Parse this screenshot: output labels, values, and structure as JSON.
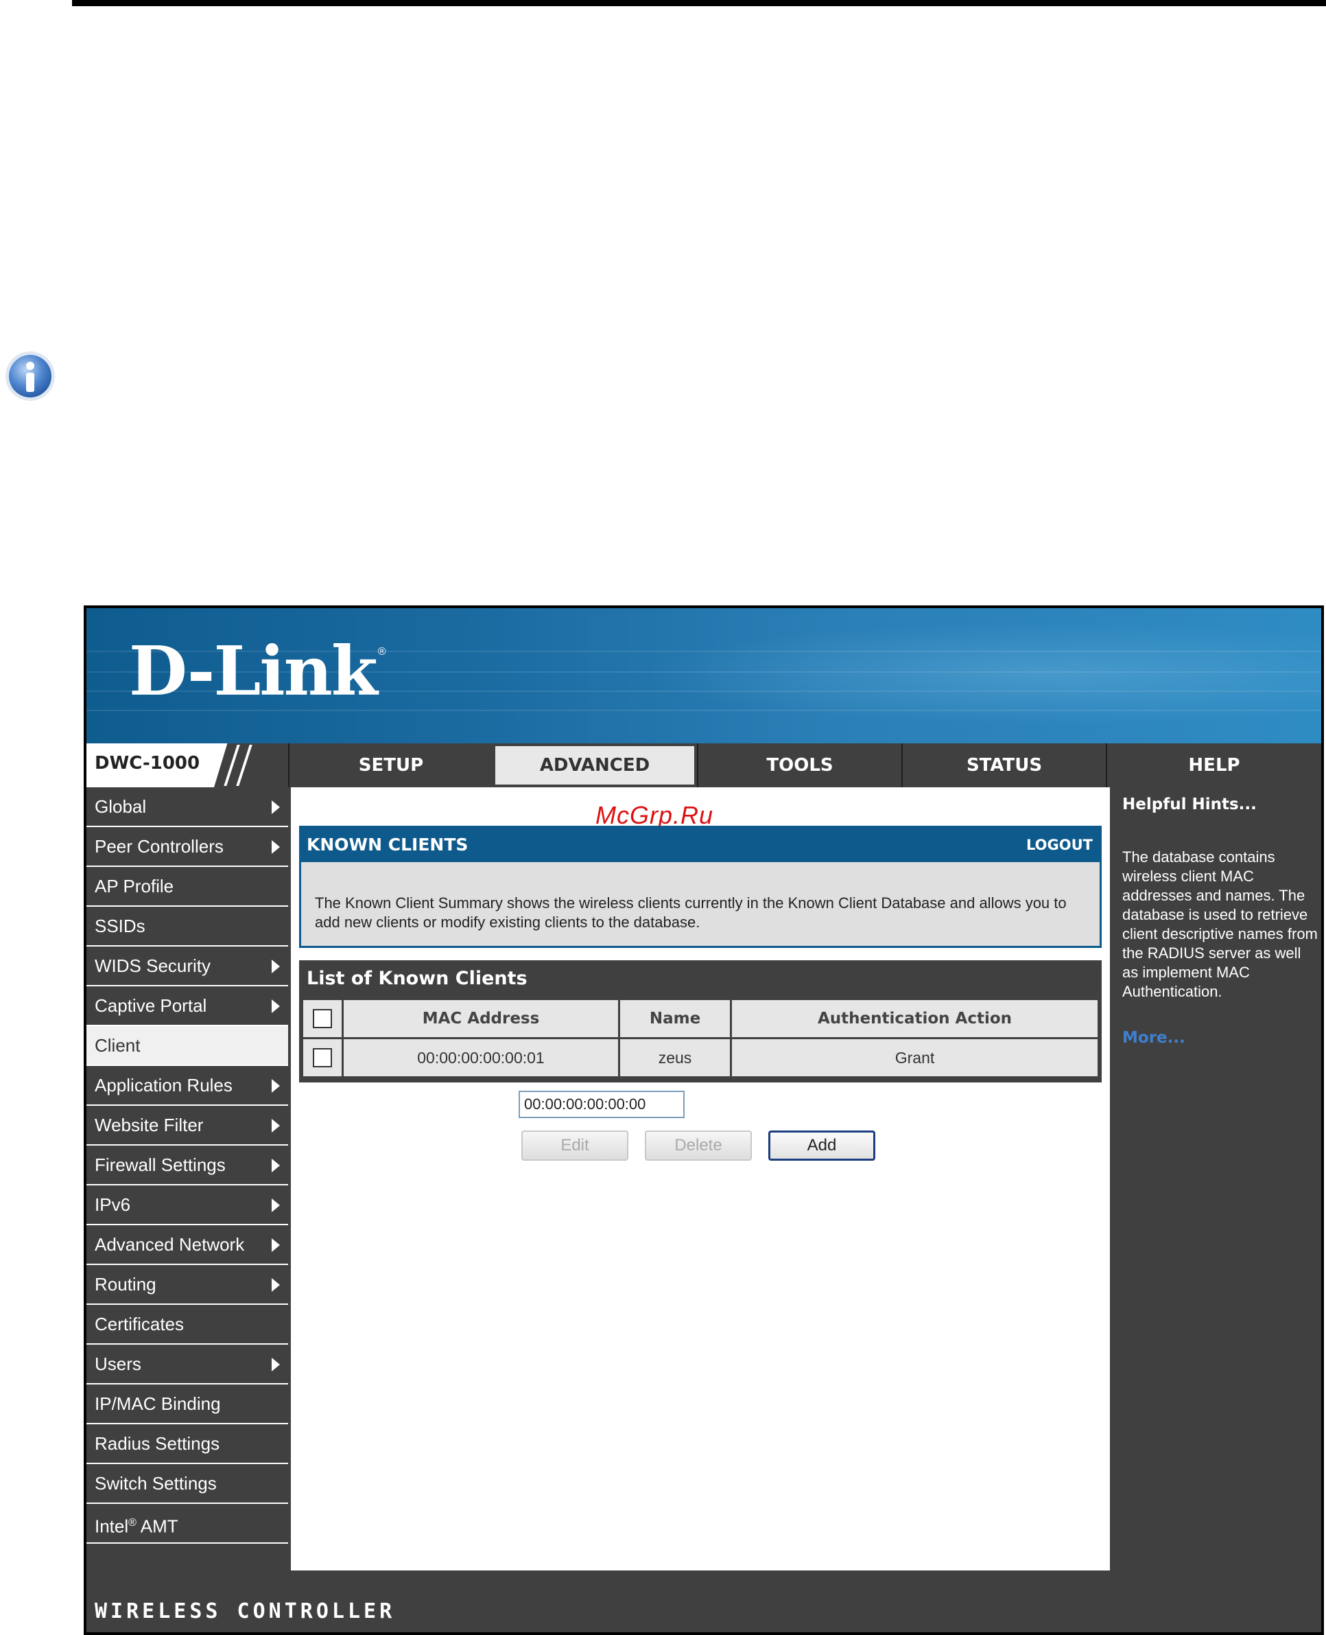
{
  "brand": {
    "logo_text": "D-Link",
    "registered_mark": "®"
  },
  "model": "DWC-1000",
  "nav_tabs": [
    "SETUP",
    "ADVANCED",
    "TOOLS",
    "STATUS",
    "HELP"
  ],
  "active_tab": "ADVANCED",
  "sidebar": {
    "items": [
      {
        "label": "Global",
        "arrow": true
      },
      {
        "label": "Peer Controllers",
        "arrow": true
      },
      {
        "label": "AP Profile",
        "arrow": false
      },
      {
        "label": "SSIDs",
        "arrow": false
      },
      {
        "label": "WIDS Security",
        "arrow": true
      },
      {
        "label": "Captive Portal",
        "arrow": true
      },
      {
        "label": "Client",
        "arrow": false,
        "active": true
      },
      {
        "label": "Application Rules",
        "arrow": true
      },
      {
        "label": "Website Filter",
        "arrow": true
      },
      {
        "label": "Firewall Settings",
        "arrow": true
      },
      {
        "label": "IPv6",
        "arrow": true
      },
      {
        "label": "Advanced Network",
        "arrow": true
      },
      {
        "label": "Routing",
        "arrow": true
      },
      {
        "label": "Certificates",
        "arrow": false
      },
      {
        "label": "Users",
        "arrow": true
      },
      {
        "label": "IP/MAC Binding",
        "arrow": false
      },
      {
        "label": "Radius Settings",
        "arrow": false
      },
      {
        "label": "Switch Settings",
        "arrow": false
      },
      {
        "label": "Intel",
        "sup": "®",
        "suffix": " AMT",
        "arrow": false
      }
    ]
  },
  "watermark": "McGrp.Ru",
  "known_clients": {
    "title": "KNOWN CLIENTS",
    "logout": "LOGOUT",
    "description": "The Known Client Summary shows the wireless clients currently in the Known Client Database and allows you to add new clients or modify existing clients to the database."
  },
  "list": {
    "title": "List of Known Clients",
    "columns": [
      "MAC Address",
      "Name",
      "Authentication Action"
    ],
    "rows": [
      {
        "mac": "00:00:00:00:00:01",
        "name": "zeus",
        "action": "Grant"
      }
    ]
  },
  "mac_input": {
    "value": "00:00:00:00:00:00"
  },
  "buttons": {
    "edit": "Edit",
    "delete": "Delete",
    "add": "Add"
  },
  "help": {
    "title": "Helpful Hints...",
    "text": "The database contains wireless client MAC addresses and names. The database is used to retrieve client descriptive names from the RADIUS server as well as implement MAC Authentication.",
    "more": "More..."
  },
  "footer": "WIRELESS CONTROLLER",
  "colors": {
    "header_blue": "#0e5a8c",
    "panel_gray": "#404040",
    "link_blue": "#3f7fd0",
    "watermark_red": "#dd1111"
  }
}
